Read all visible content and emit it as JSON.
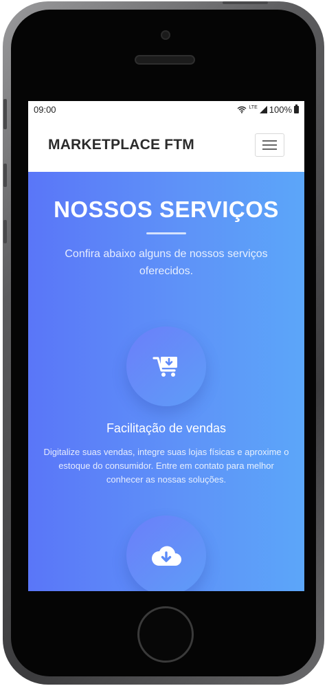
{
  "status_bar": {
    "time": "09:00",
    "network": "LTE",
    "battery": "100%"
  },
  "navbar": {
    "brand": "MARKETPLACE FTM",
    "menu_icon": "hamburger-menu-icon"
  },
  "services": {
    "title": "NOSSOS SERVIÇOS",
    "subtitle": "Confira abaixo alguns de nossos serviços oferecidos.",
    "items": [
      {
        "icon": "cart-download-icon",
        "name": "Facilitação de vendas",
        "description": "Digitalize suas vendas, integre suas lojas físicas e aproxime o estoque do consumidor. Entre em contato para melhor conhecer as nossas soluções."
      },
      {
        "icon": "cloud-download-icon"
      }
    ]
  },
  "colors": {
    "gradient_start": "#5a76f8",
    "gradient_end": "#5ca6f9",
    "navbar_bg": "#ffffff",
    "brand_text": "#2b2b2b",
    "phone_frame": "#050505"
  }
}
